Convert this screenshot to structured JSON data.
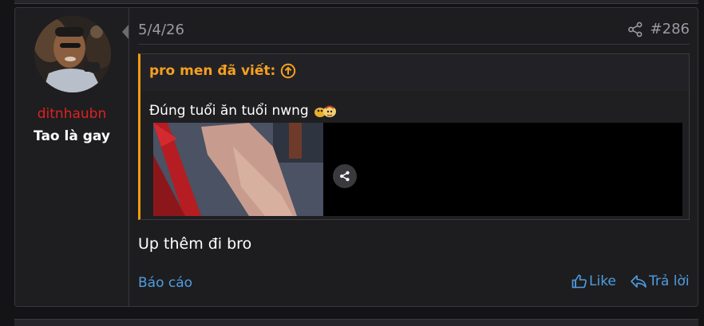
{
  "post": {
    "user": {
      "username": "ditnhaubn",
      "title": "Tao là gay",
      "username_color": "#e02020"
    },
    "date": "5/4/26",
    "post_number": "#286",
    "quote": {
      "author_line": "pro men đã viết:",
      "text": "Đúng tuổi ăn tuổi nwng",
      "accent_color": "#f39c12"
    },
    "body": "Up thêm đi bro",
    "actions": {
      "report": "Báo cáo",
      "like": "Like",
      "reply": "Trả lời"
    },
    "icons": [
      "share-icon",
      "arrow-up-circle-icon",
      "emoji-icon",
      "thumbs-up-icon",
      "reply-arrow-icon"
    ],
    "link_color": "#4f9de0"
  }
}
